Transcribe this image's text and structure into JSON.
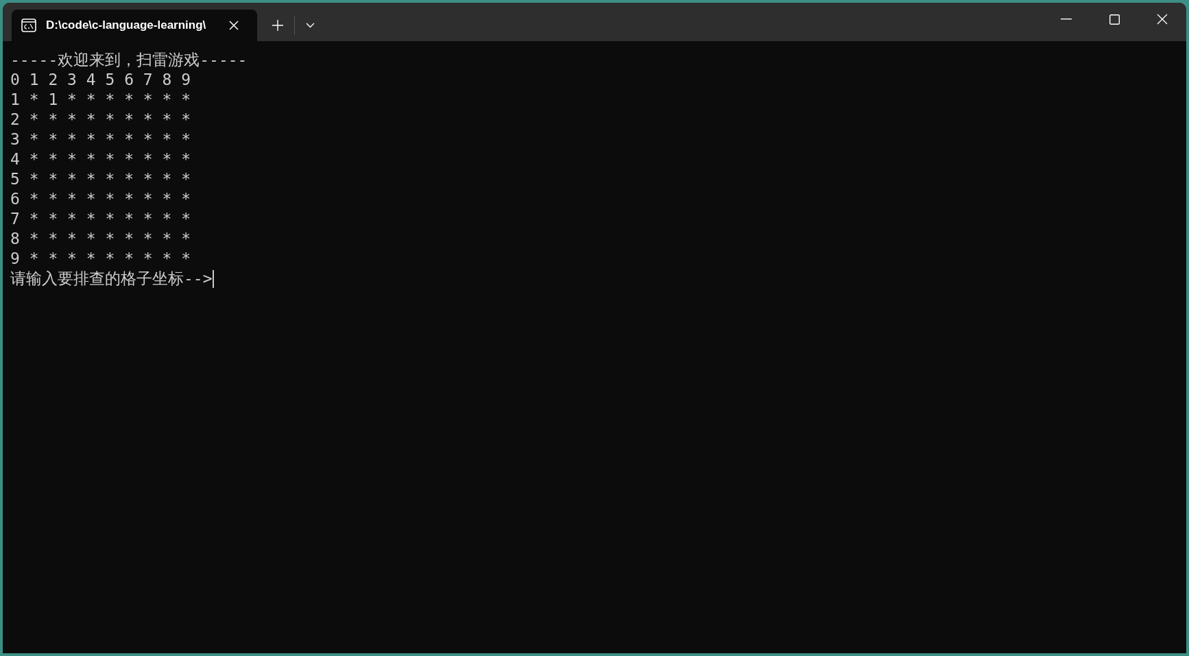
{
  "window": {
    "tab_title": "D:\\code\\c-language-learning\\"
  },
  "console": {
    "lines": [
      "-----欢迎来到，扫雷游戏-----",
      "0 1 2 3 4 5 6 7 8 9",
      "1 * 1 * * * * * * *",
      "2 * * * * * * * * *",
      "3 * * * * * * * * *",
      "4 * * * * * * * * *",
      "5 * * * * * * * * *",
      "6 * * * * * * * * *",
      "7 * * * * * * * * *",
      "8 * * * * * * * * *",
      "9 * * * * * * * * *"
    ],
    "prompt": "请输入要排查的格子坐标-->"
  }
}
